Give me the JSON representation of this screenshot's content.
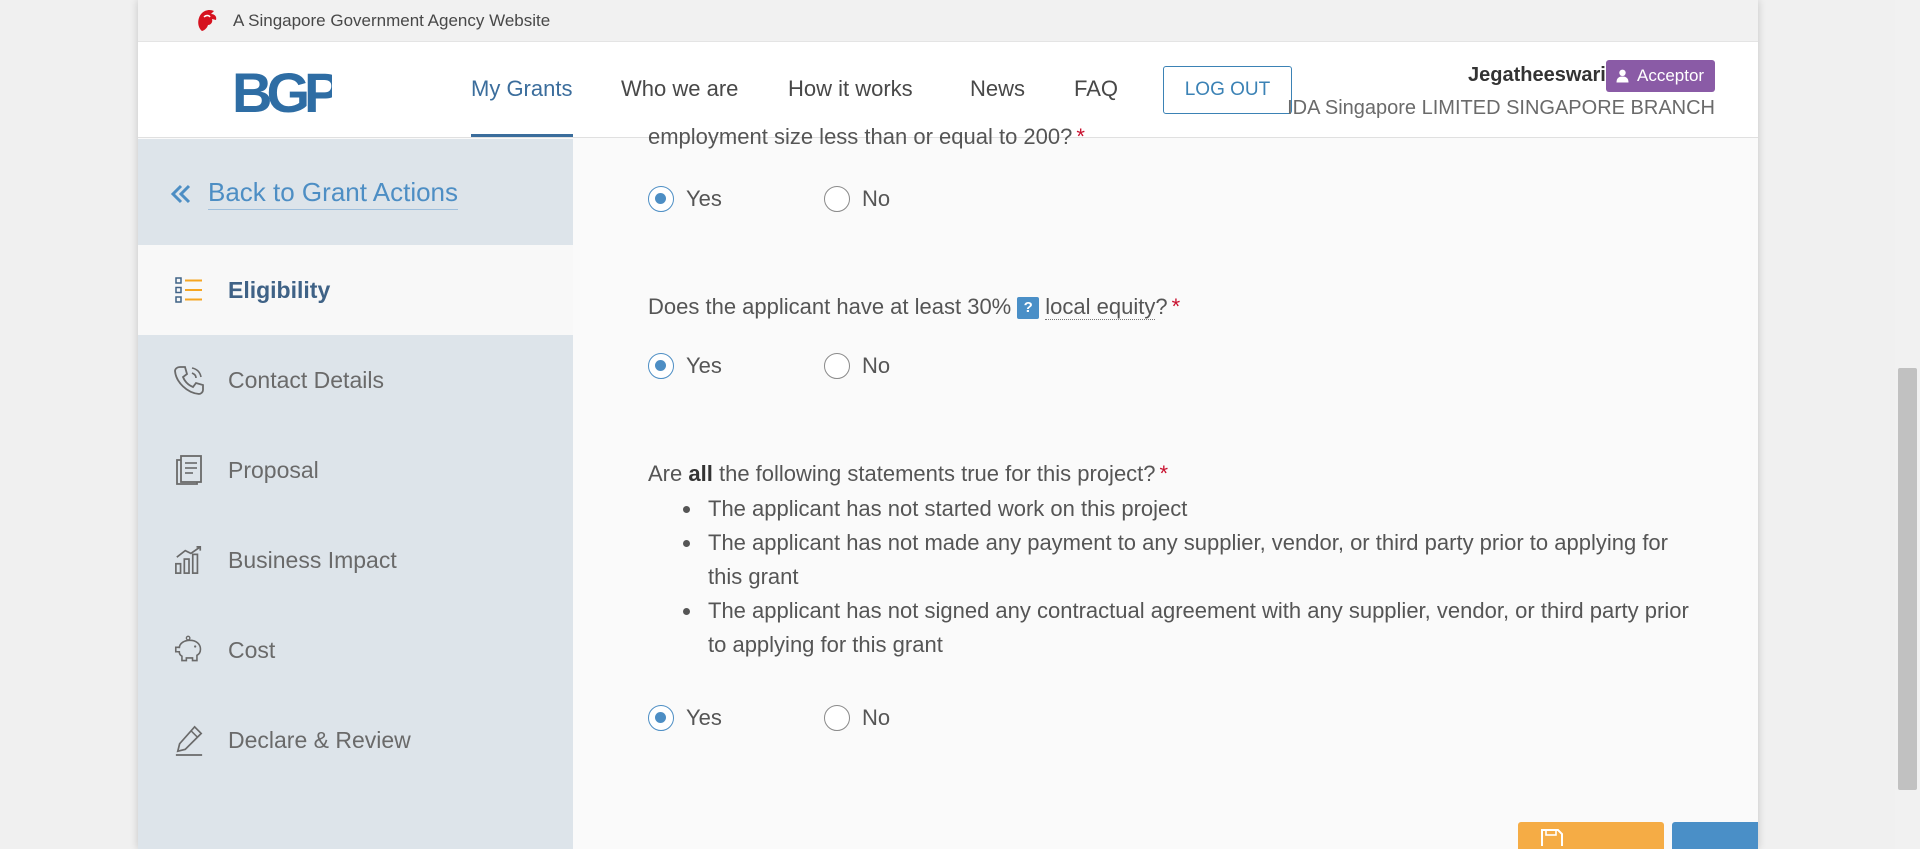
{
  "masthead": {
    "text": "A Singapore Government Agency Website"
  },
  "header": {
    "logo_text": "BGP",
    "nav": [
      {
        "label": "My Grants",
        "active": true
      },
      {
        "label": "Who we are"
      },
      {
        "label": "How it works"
      },
      {
        "label": "News"
      },
      {
        "label": "FAQ"
      }
    ],
    "logout_label": "LOG OUT",
    "user_name": "Jegatheeswari",
    "role": "Acceptor",
    "company": "IDA Singapore LIMITED SINGAPORE BRANCH"
  },
  "sidebar": {
    "back_label": "Back to Grant Actions",
    "items": [
      {
        "label": "Eligibility",
        "icon": "list-icon",
        "active": true
      },
      {
        "label": "Contact Details",
        "icon": "phone-icon"
      },
      {
        "label": "Proposal",
        "icon": "document-icon"
      },
      {
        "label": "Business Impact",
        "icon": "bar-chart-icon"
      },
      {
        "label": "Cost",
        "icon": "piggy-bank-icon"
      },
      {
        "label": "Declare & Review",
        "icon": "pen-icon"
      }
    ]
  },
  "content": {
    "q1_partial": "employment size less than or equal to 200?",
    "q1_answer": "Yes",
    "q2_prefix": "Does the applicant have at least 30%",
    "q2_help": "?",
    "q2_term": "local equity",
    "q2_suffix": "?",
    "q2_answer": "Yes",
    "q3_prefix": "Are",
    "q3_bold": "all",
    "q3_suffix": "the following statements true for this project?",
    "q3_statements": [
      "The applicant has not started work on this project",
      "The applicant has not made any payment to any supplier, vendor, or third party prior to applying for this grant",
      "The applicant has not signed any contractual agreement with any supplier, vendor, or third party prior to applying for this grant"
    ],
    "q3_answer": "Yes",
    "required_mark": "*",
    "yes_label": "Yes",
    "no_label": "No"
  },
  "colors": {
    "accent": "#3b6d9c",
    "link": "#4d8ec4",
    "role_badge": "#8a5ba6",
    "required": "#c8102e",
    "save_button": "#f5ac45",
    "next_button": "#4a8fc7"
  }
}
